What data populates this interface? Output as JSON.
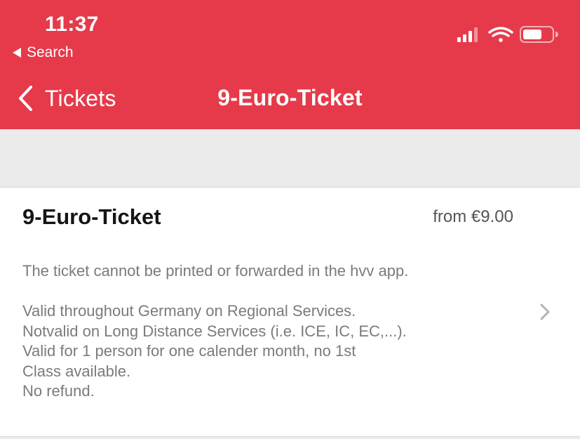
{
  "status_bar": {
    "time": "11:37",
    "back_app": "Search",
    "icons": [
      "cellular-signal-icon",
      "wifi-icon",
      "battery-icon"
    ]
  },
  "nav": {
    "back_label": "Tickets",
    "title": "9-Euro-Ticket"
  },
  "ticket": {
    "title": "9-Euro-Ticket",
    "price": "from €9.00",
    "note": "The ticket cannot be printed or forwarded in the hvv app.",
    "details": [
      "Valid throughout Germany on Regional Services.",
      "Notvalid on Long Distance Services (i.e. ICE, IC, EC,...).",
      "Valid for 1 person for one calender month, no 1st",
      "Class available.",
      "No refund."
    ]
  },
  "colors": {
    "header": "#e63a4b",
    "background": "#ebebeb",
    "card": "#ffffff",
    "muted_text": "#7b7b7b"
  }
}
